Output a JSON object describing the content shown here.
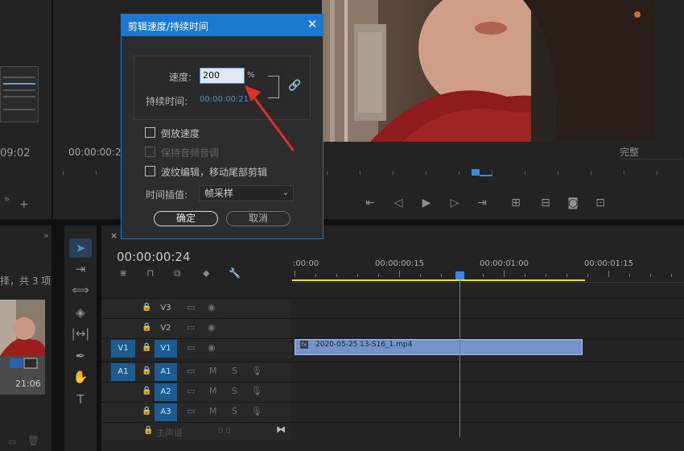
{
  "left_top": {
    "timecode": "09:02"
  },
  "program": {
    "timecode": "00:00:00:2",
    "fit": "完整"
  },
  "project": {
    "count_text": "择，共 3 项",
    "duration": "21:06"
  },
  "timeline": {
    "close": "×",
    "timecode": "00:00:00:24",
    "ruler": [
      ":00:00",
      "00:00:00:15",
      "00:00:01:00",
      "00:00:01:15"
    ],
    "tracks": [
      {
        "src": "",
        "target": "V3"
      },
      {
        "src": "",
        "target": "V2"
      },
      {
        "src": "V1",
        "target": "V1"
      },
      {
        "src": "A1",
        "target": "A1"
      },
      {
        "src": "",
        "target": "A2"
      },
      {
        "src": "",
        "target": "A3"
      }
    ],
    "clip_name": "2020-05-25 13-S16_1.mp4",
    "master_label": "主声道",
    "master_value": "0.0",
    "audio_m": "M",
    "audio_s": "S"
  },
  "dialog": {
    "title": "剪辑速度/持续时间",
    "close": "✕",
    "speed_label": "速度:",
    "speed_value": "200",
    "speed_unit": "%",
    "duration_label": "持续时间:",
    "duration_value": "00:00:00:21",
    "options": [
      {
        "label": "倒放速度",
        "checked": false,
        "enabled": true
      },
      {
        "label": "保持音频音调",
        "checked": false,
        "enabled": false
      },
      {
        "label": "波纹编辑，移动尾部剪辑",
        "checked": false,
        "enabled": true
      }
    ],
    "interp_label": "时间插值:",
    "interp_value": "帧采样",
    "ok": "确定",
    "cancel": "取消"
  },
  "colors": {
    "accent": "#1c79d1",
    "timecode_blue": "#3b94e4",
    "track_blue": "#1b5c92",
    "clip": "#7393c9",
    "arrow": "#e0302a",
    "work_area": "#e8e32a"
  }
}
